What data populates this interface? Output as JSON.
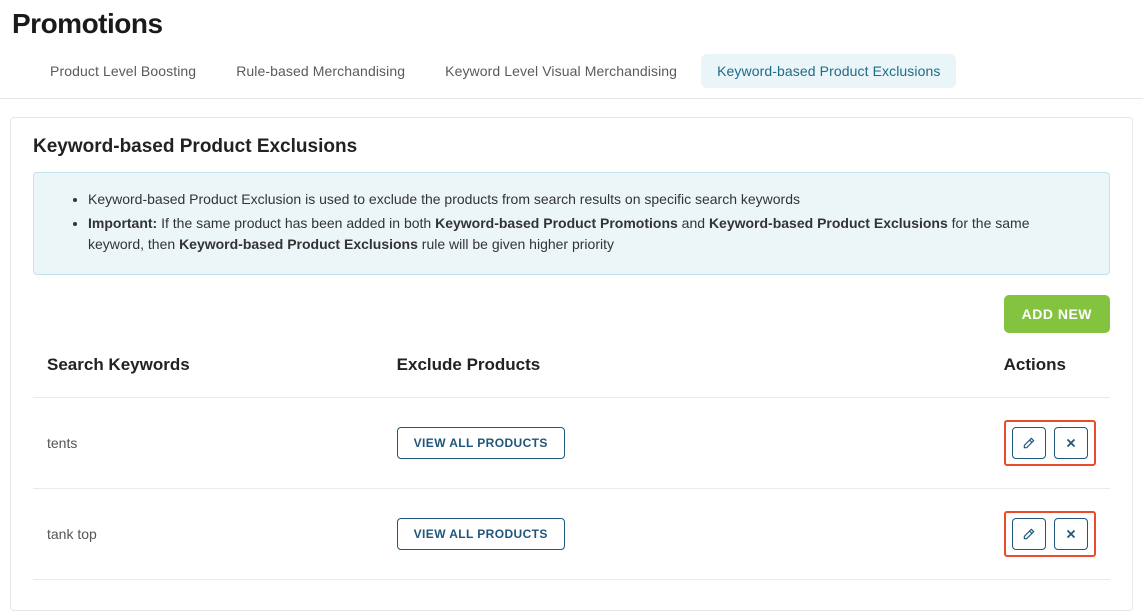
{
  "page_title": "Promotions",
  "tabs": [
    {
      "label": "Product Level Boosting",
      "active": false
    },
    {
      "label": "Rule-based Merchandising",
      "active": false
    },
    {
      "label": "Keyword Level Visual Merchandising",
      "active": false
    },
    {
      "label": "Keyword-based Product Exclusions",
      "active": true
    }
  ],
  "panel": {
    "title": "Keyword-based Product Exclusions",
    "info": {
      "line1": "Keyword-based Product Exclusion is used to exclude the products from search results on specific search keywords",
      "line2_prefix": "Important:",
      "line2_part1": " If the same product has been added in both ",
      "line2_bold1": "Keyword-based Product Promotions",
      "line2_mid": " and ",
      "line2_bold2": "Keyword-based Product Exclusions",
      "line2_part2": " for the same keyword, then ",
      "line2_bold3": "Keyword-based Product Exclusions",
      "line2_end": " rule will be given higher priority"
    }
  },
  "buttons": {
    "add_new": "ADD NEW",
    "view_all": "VIEW ALL PRODUCTS"
  },
  "table": {
    "headers": {
      "keywords": "Search Keywords",
      "exclude": "Exclude Products",
      "actions": "Actions"
    },
    "rows": [
      {
        "keyword": "tents"
      },
      {
        "keyword": "tank top"
      }
    ]
  },
  "icons": {
    "edit": "edit-icon",
    "delete": "close-icon"
  }
}
